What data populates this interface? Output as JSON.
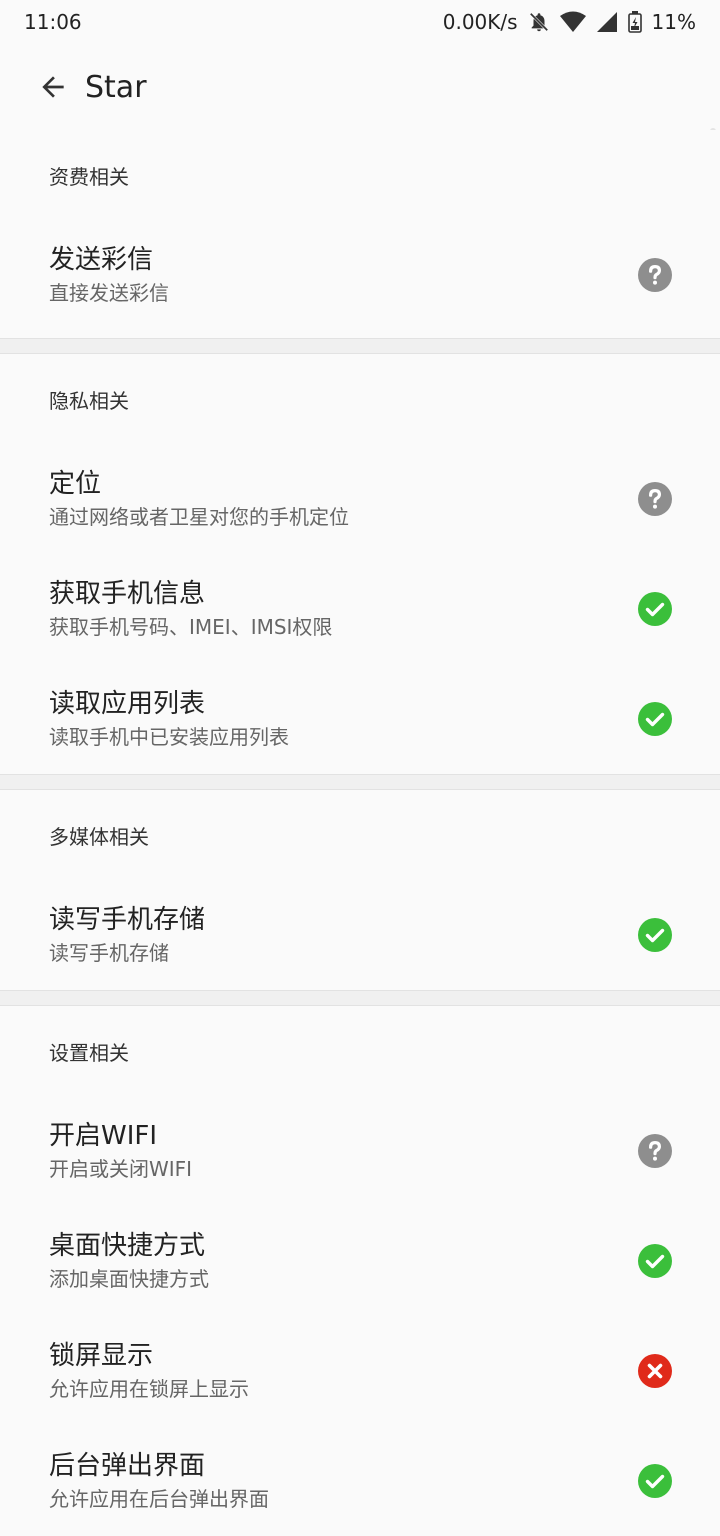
{
  "status_bar": {
    "time": "11:06",
    "net_speed": "0.00K/s",
    "battery": "11%",
    "icons": [
      "bell-off-icon",
      "wifi-icon",
      "cell-signal-icon",
      "battery-icon"
    ]
  },
  "app_bar": {
    "back_icon": "arrow-left-icon",
    "title": "Star"
  },
  "colors": {
    "unknown": "#8e8e8e",
    "granted": "#3bbf3b",
    "denied": "#e02a1a"
  },
  "sections": [
    {
      "title": "资费相关",
      "items": [
        {
          "title": "发送彩信",
          "subtitle": "直接发送彩信",
          "status": "unknown"
        }
      ]
    },
    {
      "title": "隐私相关",
      "items": [
        {
          "title": "定位",
          "subtitle": "通过网络或者卫星对您的手机定位",
          "status": "unknown"
        },
        {
          "title": "获取手机信息",
          "subtitle": "获取手机号码、IMEI、IMSI权限",
          "status": "granted"
        },
        {
          "title": "读取应用列表",
          "subtitle": "读取手机中已安装应用列表",
          "status": "granted"
        }
      ]
    },
    {
      "title": "多媒体相关",
      "items": [
        {
          "title": "读写手机存储",
          "subtitle": "读写手机存储",
          "status": "granted"
        }
      ]
    },
    {
      "title": "设置相关",
      "items": [
        {
          "title": "开启WIFI",
          "subtitle": "开启或关闭WIFI",
          "status": "unknown"
        },
        {
          "title": "桌面快捷方式",
          "subtitle": "添加桌面快捷方式",
          "status": "granted"
        },
        {
          "title": "锁屏显示",
          "subtitle": "允许应用在锁屏上显示",
          "status": "denied"
        },
        {
          "title": "后台弹出界面",
          "subtitle": "允许应用在后台弹出界面",
          "status": "granted"
        }
      ]
    }
  ]
}
